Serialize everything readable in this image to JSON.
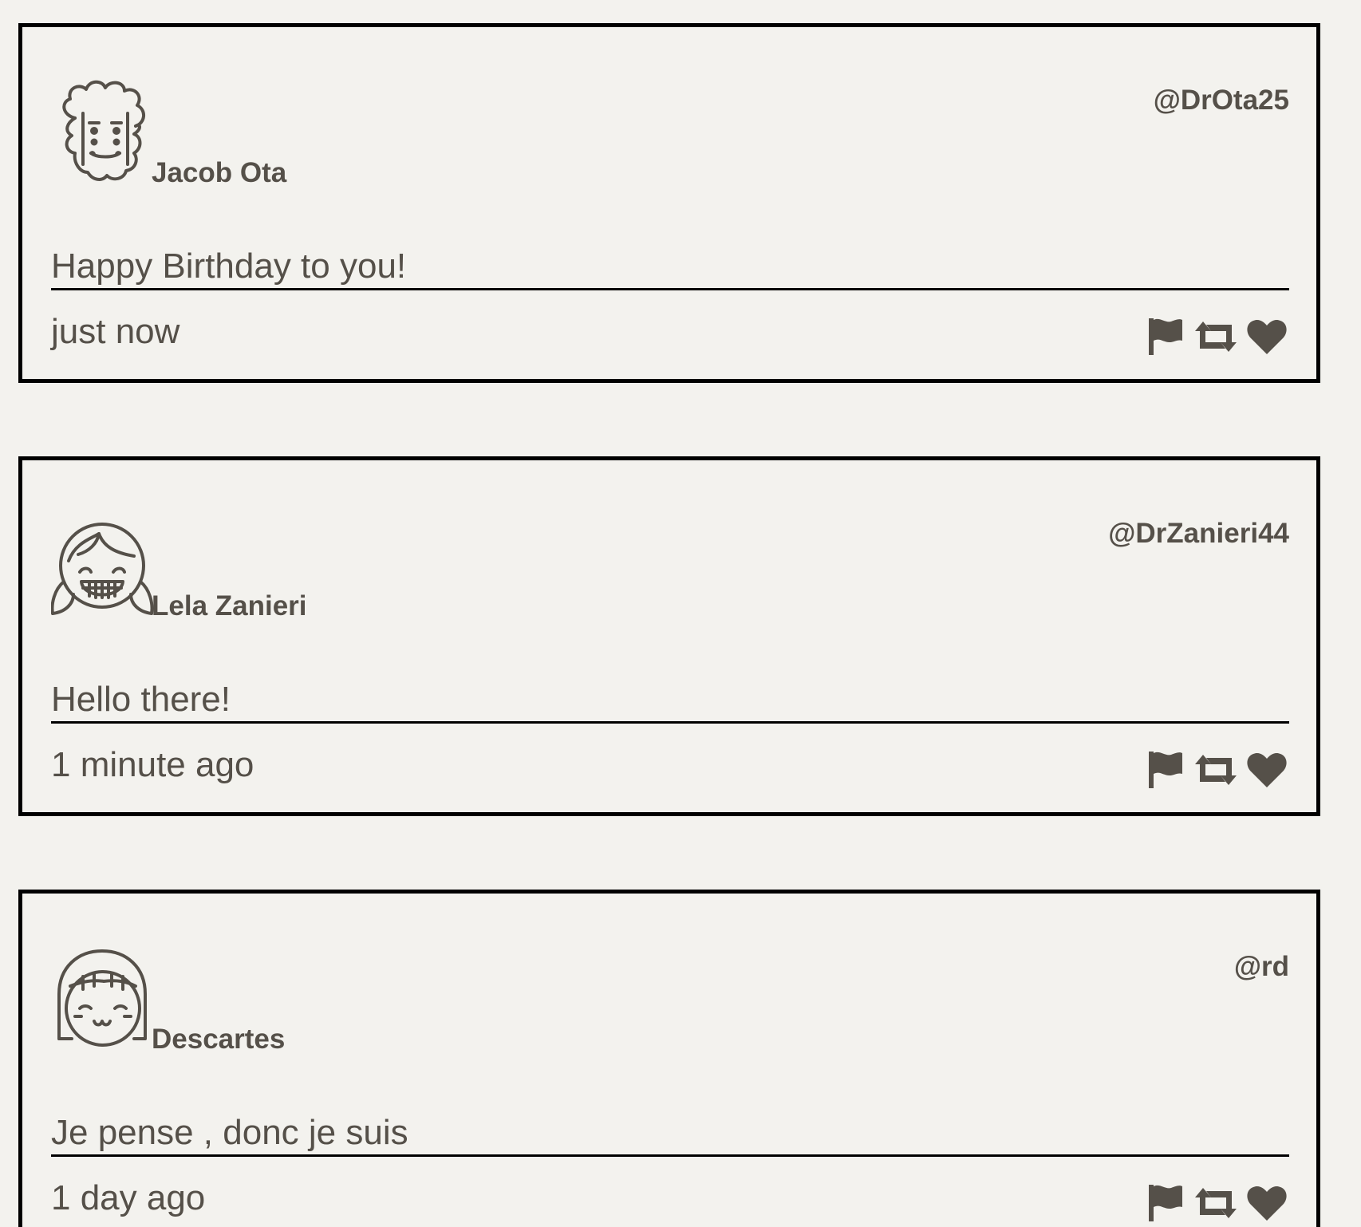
{
  "tweets": [
    {
      "avatar_icon": "curly-hair-man-avatar-icon",
      "display_name": "Jacob Ota",
      "handle": "@DrOta25",
      "message": "Happy Birthday to you!",
      "timestamp": "just now"
    },
    {
      "avatar_icon": "pigtails-girl-avatar-icon",
      "display_name": "Lela Zanieri",
      "handle": "@DrZanieri44",
      "message": "Hello there!",
      "timestamp": "1 minute ago"
    },
    {
      "avatar_icon": "bob-hair-girl-avatar-icon",
      "display_name": "Descartes",
      "handle": "@rd",
      "message": "Je pense , donc je suis",
      "timestamp": "1 day ago"
    }
  ],
  "action_icons": [
    "flag-icon",
    "retweet-icon",
    "heart-icon"
  ],
  "colors": {
    "background": "#f3f2ee",
    "text": "#555049",
    "border": "#000000"
  }
}
